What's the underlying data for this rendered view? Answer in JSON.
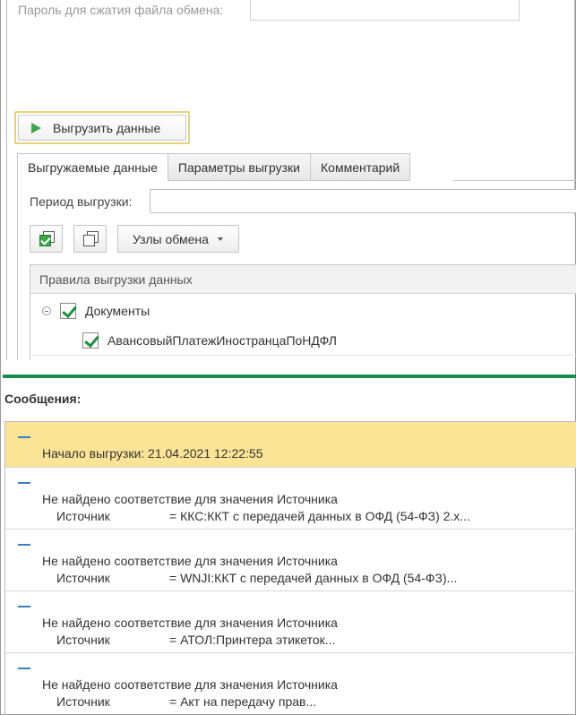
{
  "form": {
    "password_label": "Пароль для сжатия файла обмена:",
    "password_value": "",
    "export_button": "Выгрузить данные"
  },
  "tabs": [
    {
      "label": "Выгружаемые данные",
      "active": true
    },
    {
      "label": "Параметры выгрузки",
      "active": false
    },
    {
      "label": "Комментарий",
      "active": false
    }
  ],
  "export_panel": {
    "period_label": "Период выгрузки:",
    "period_value": "",
    "nodes_button": "Узлы обмена",
    "rules_header": "Правила выгрузки данных",
    "tree": [
      {
        "label": "Документы",
        "checked": true,
        "level": 0
      },
      {
        "label": "АвансовыйПлатежИностранцаПоНДФЛ",
        "checked": true,
        "level": 1
      }
    ]
  },
  "messages_title": "Сообщения:",
  "messages": [
    {
      "line1": "Начало выгрузки: 21.04.2021 12:22:55",
      "highlighted": true
    },
    {
      "line1": "Не найдено соответствие для значения Источника",
      "source_label": "Источник",
      "source_value": "=  ККС:ККТ с передачей данных в ОФД (54-ФЗ) 2.х..."
    },
    {
      "line1": "Не найдено соответствие для значения Источника",
      "source_label": "Источник",
      "source_value": "=  WNJI:ККТ с передачей данных в ОФД (54-ФЗ)..."
    },
    {
      "line1": "Не найдено соответствие для значения Источника",
      "source_label": "Источник",
      "source_value": "=  АТОЛ:Принтера этикеток..."
    },
    {
      "line1": "Не найдено соответствие для значения Источника",
      "source_label": "Источник",
      "source_value": "=  Акт на передачу прав..."
    }
  ],
  "colors": {
    "accent_green": "#1a8c4a",
    "highlight": "#fbe496",
    "play_icon": "#3da84a",
    "dash_icon": "#3a7fc4"
  }
}
